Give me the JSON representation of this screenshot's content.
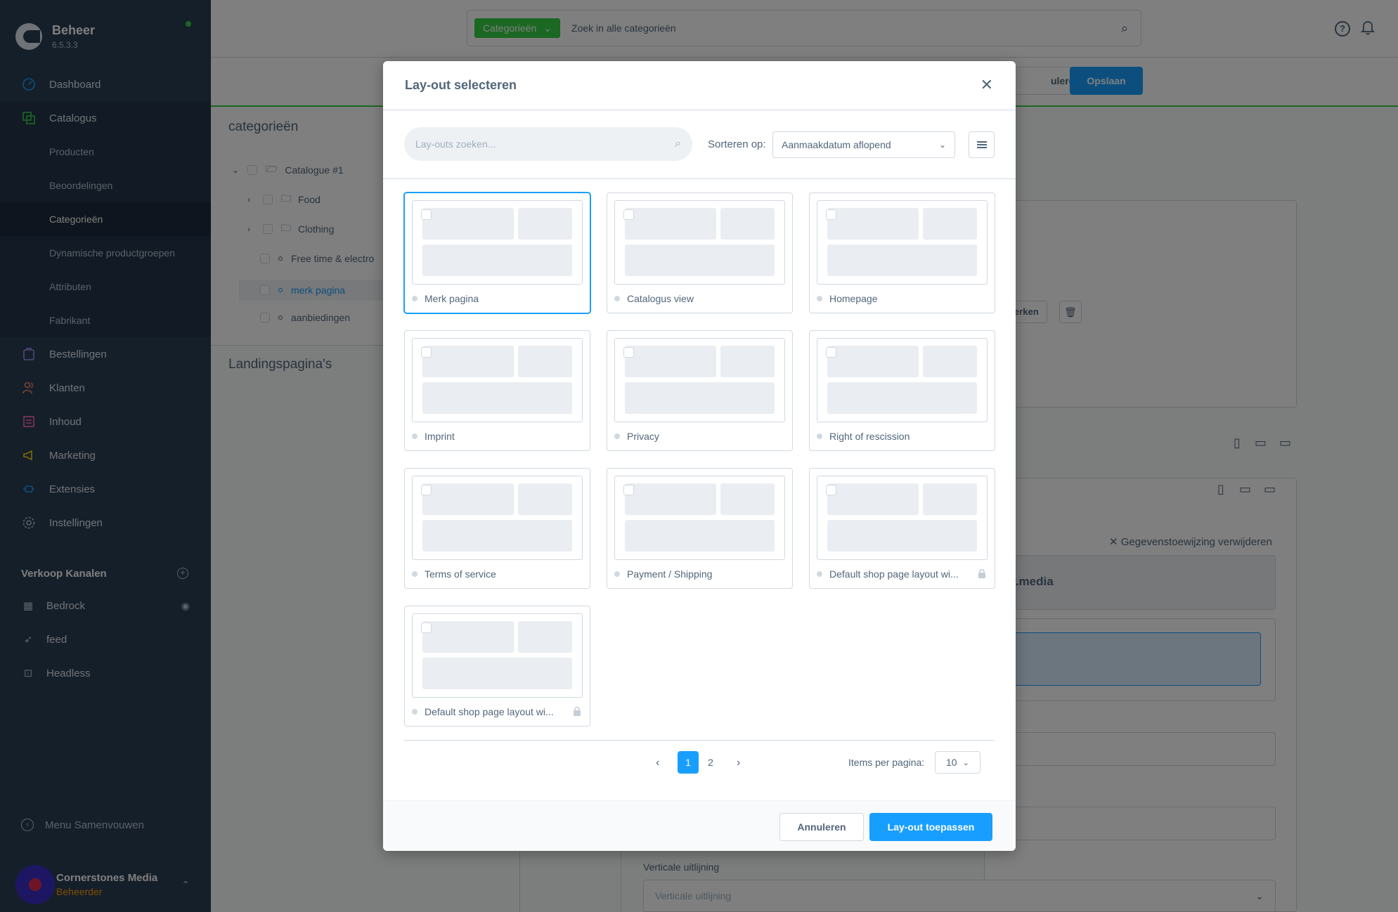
{
  "brand": {
    "title": "Beheer",
    "version": "6.5.3.3"
  },
  "nav": {
    "dashboard": "Dashboard",
    "catalogus": "Catalogus",
    "sub": [
      "Producten",
      "Beoordelingen",
      "Categorieën",
      "Dynamische productgroepen",
      "Attributen",
      "Fabrikant"
    ],
    "bestellingen": "Bestellingen",
    "klanten": "Klanten",
    "inhoud": "Inhoud",
    "marketing": "Marketing",
    "extensies": "Extensies",
    "instellingen": "Instellingen"
  },
  "sales_channels": {
    "title": "Verkoop Kanalen",
    "items": [
      "Bedrock",
      "feed",
      "Headless"
    ]
  },
  "collapse_label": "Menu Samenvouwen",
  "user": {
    "name": "Cornerstones Media",
    "role": "Beheerder"
  },
  "topbar": {
    "category_button": "Categorieën",
    "search_placeholder": "Zoek in alle categorieën"
  },
  "toolbar": {
    "cancel": "uleren",
    "save": "Opslaan"
  },
  "tree": {
    "title": "categorieën",
    "items": [
      "Catalogue #1",
      "Food",
      "Clothing",
      "Free time & electro",
      "merk pagina",
      "aanbiedingen"
    ]
  },
  "landing_title": "Landingspagina's",
  "bg": {
    "edit_button": "erken",
    "remove_assignment": "Gegevenstoewijzing verwijderen",
    "media": "ry.media",
    "vertical_label": "Verticale uitlijning",
    "vertical_placeholder": "Verticale uitlijning"
  },
  "modal": {
    "title": "Lay-out selecteren",
    "search_placeholder": "Lay-outs zoeken...",
    "sort_label": "Sorteren op:",
    "sort_value": "Aanmaakdatum aflopend",
    "layouts": [
      "Merk pagina",
      "Catalogus view",
      "Homepage",
      "Imprint",
      "Privacy",
      "Right of rescission",
      "Terms of service",
      "Payment / Shipping",
      "Default shop page layout wi...",
      "Default shop page layout wi..."
    ],
    "pagination": {
      "pages": [
        "1",
        "2"
      ],
      "current": "1",
      "items_per_page_label": "Items per pagina:",
      "items_per_page": "10"
    },
    "cancel": "Annuleren",
    "apply": "Lay-out toepassen"
  },
  "colors": {
    "sidebar": "#2b3e54",
    "accent_blue": "#189eff",
    "accent_green": "#37d046",
    "avatar": "#3b2fc6"
  }
}
